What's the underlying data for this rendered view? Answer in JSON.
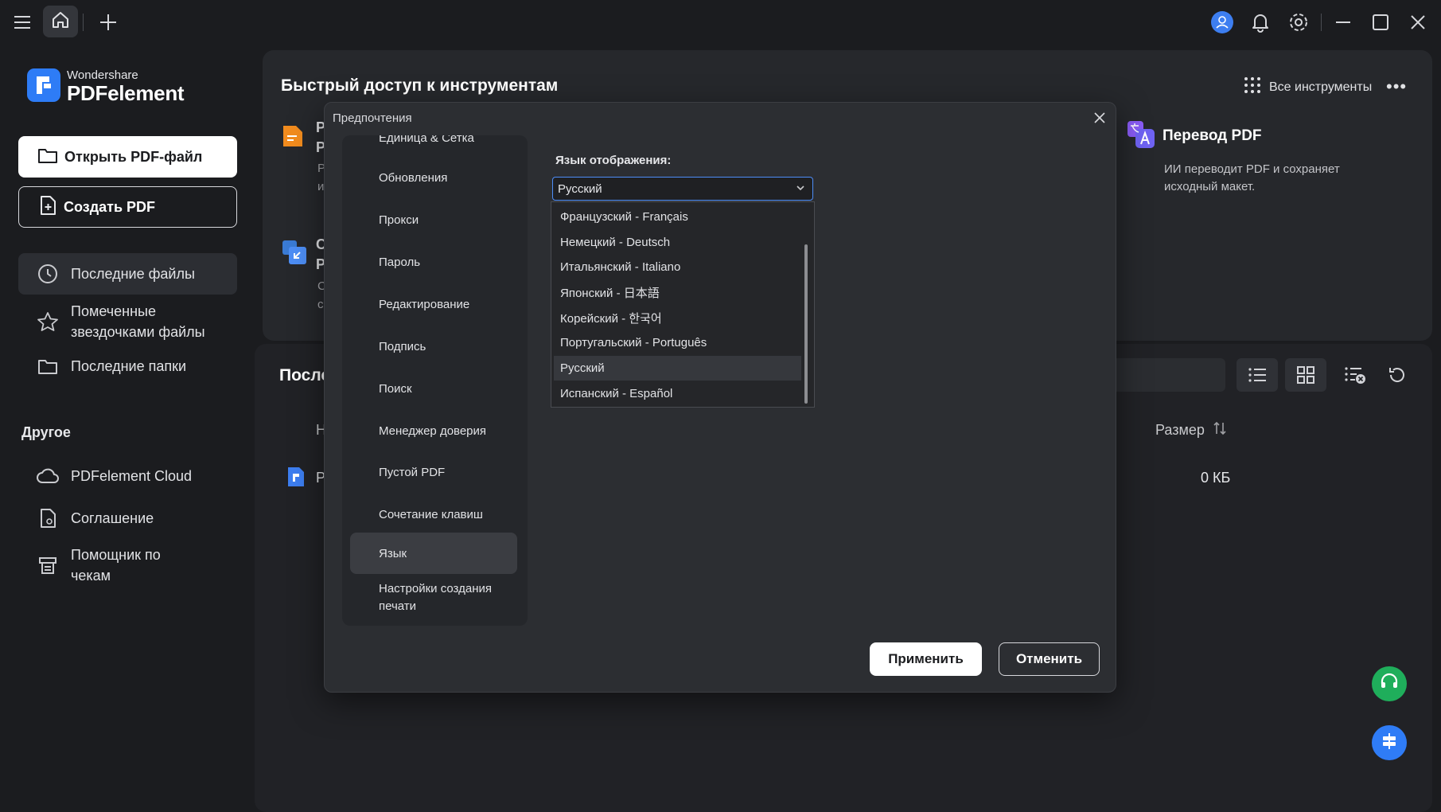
{
  "titlebar": {
    "icons": [
      "menu-icon",
      "home-icon",
      "plus-icon",
      "avatar-icon",
      "bell-icon",
      "gear-icon",
      "minimize-icon",
      "maximize-icon",
      "close-icon"
    ]
  },
  "sidebar": {
    "brand_small": "Wondershare",
    "brand_big": "PDFelement",
    "open_pdf": "Открыть PDF-файл",
    "create_pdf": "Создать PDF",
    "items": [
      {
        "label": "Последние файлы",
        "icon": "clock-icon"
      },
      {
        "label": "Помеченные звездочками файлы",
        "icon": "star-icon"
      },
      {
        "label": "Последние папки",
        "icon": "folder-icon"
      }
    ],
    "other_label": "Другое",
    "other_items": [
      {
        "label": "PDFelement Cloud",
        "icon": "cloud-icon"
      },
      {
        "label": "Соглашение",
        "icon": "document-icon"
      },
      {
        "label": "Помощник по чекам",
        "icon": "receipt-icon"
      }
    ]
  },
  "main": {
    "quick_access_title": "Быстрый доступ к инструментам",
    "all_tools": "Все инструменты",
    "more": "•••",
    "tools": [
      {
        "title": "Перевод PDF",
        "desc": "ИИ переводит PDF и сохраняет исходный макет.",
        "icon": "translate-icon"
      }
    ],
    "partial_letters": {
      "t1a": "Р",
      "t1b": "Р",
      "t1c": "Р",
      "t1d": "и",
      "t2a": "С",
      "t2b": "Р",
      "t2c": "С",
      "t2d": "с"
    },
    "recent_title": "После",
    "table": {
      "col_name_partial": "Н",
      "col_size": "Размер",
      "row_name_partial": "Р",
      "row_size": "0 КБ"
    }
  },
  "dialog": {
    "title": "Предпочтения",
    "nav_items": [
      "Единица & Сетка",
      "Обновления",
      "Прокси",
      "Пароль",
      "Редактирование",
      "Подпись",
      "Поиск",
      "Менеджер доверия",
      "Пустой PDF",
      "Сочетание клавиш",
      "Язык",
      "Настройки создания печати"
    ],
    "active_nav": "Язык",
    "language_label": "Язык отображения:",
    "selected_language": "Русский",
    "options": [
      "Французский - Français",
      "Немецкий - Deutsch",
      "Итальянский - Italiano",
      "Японский - 日本語",
      "Корейский - 한국어",
      "Португальский - Português",
      "Русский",
      "Испанский - Español"
    ],
    "apply": "Применить",
    "cancel": "Отменить"
  },
  "colors": {
    "accent": "#2e7cf6",
    "background": "#1b1c1f",
    "fab_support": "#1fae5b",
    "fab_tools": "#2f7cf6"
  }
}
